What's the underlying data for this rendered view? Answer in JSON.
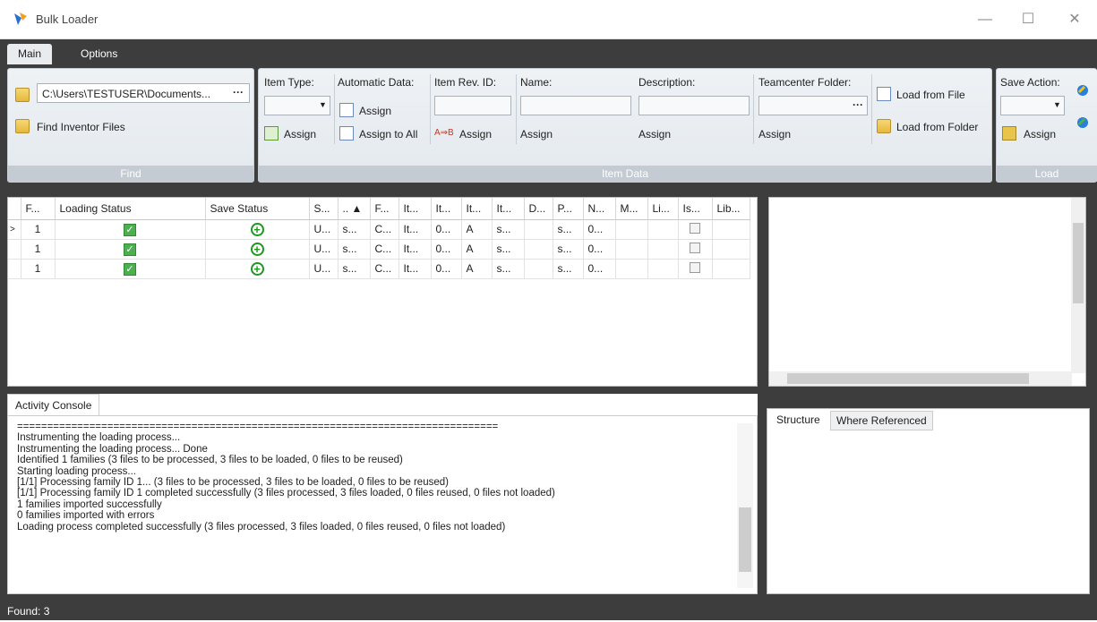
{
  "window": {
    "title": "Bulk Loader",
    "minimize": "—",
    "maximize": "☐",
    "close": "✕"
  },
  "ribbon_tabs": [
    "Main",
    "Options"
  ],
  "find_group": {
    "path_value": "C:\\Users\\TESTUSER\\Documents...",
    "browse": "···",
    "find_button": "Find Inventor Files",
    "label": "Find"
  },
  "item_data_group": {
    "item_type": "Item Type:",
    "item_type_assign": "Assign",
    "automatic_data": "Automatic Data:",
    "auto_assign": "Assign",
    "assign_to_all": "Assign to All",
    "item_rev_id": "Item Rev. ID:",
    "rev_assign": "Assign",
    "name": "Name:",
    "name_assign": "Assign",
    "description": "Description:",
    "desc_assign": "Assign",
    "tc_folder": "Teamcenter Folder:",
    "tc_browse": "···",
    "tc_assign": "Assign",
    "load_from_file": "Load from File",
    "load_from_folder": "Load from Folder",
    "label": "Item Data"
  },
  "load_group": {
    "save_action": "Save Action:",
    "assign": "Assign",
    "label": "Load"
  },
  "grid": {
    "headers": [
      "F...",
      "Loading Status",
      "Save Status",
      "S...",
      ".. ▲",
      "F...",
      "It...",
      "It...",
      "It...",
      "It...",
      "D...",
      "P...",
      "N...",
      "M...",
      "Li...",
      "Is...",
      "Lib..."
    ],
    "rows": [
      [
        "1",
        "",
        "",
        "U...",
        "s...",
        "C...",
        "It...",
        "0...",
        "A",
        "s...",
        "",
        "s...",
        "0...",
        "",
        "",
        "",
        ""
      ],
      [
        "1",
        "",
        "",
        "U...",
        "s...",
        "C...",
        "It...",
        "0...",
        "A",
        "s...",
        "",
        "s...",
        "0...",
        "",
        "",
        "",
        ""
      ],
      [
        "1",
        "",
        "",
        "U...",
        "s...",
        "C...",
        "It...",
        "0...",
        "A",
        "s...",
        "",
        "s...",
        "0...",
        "",
        "",
        "",
        ""
      ]
    ]
  },
  "console": {
    "tab": "Activity Console",
    "lines": [
      "================================================================================",
      "Instrumenting the loading process...",
      "Instrumenting the loading process... Done",
      "Identified 1 families (3 files to be processed, 3 files to be loaded, 0 files to be reused)",
      "Starting loading process...",
      "[1/1] Processing family ID 1... (3 files to be processed, 3 files to be loaded, 0 files to be reused)",
      "[1/1] Processing family ID 1 completed successfully (3 files processed, 3 files loaded, 0 files reused, 0 files not loaded)",
      "1 families imported successfully",
      "0 families imported with errors",
      "Loading process completed successfully (3 files processed, 3 files loaded, 0 files reused, 0 files not loaded)"
    ]
  },
  "structure_tabs": [
    "Structure",
    "Where Referenced"
  ],
  "status": "Found: 3"
}
